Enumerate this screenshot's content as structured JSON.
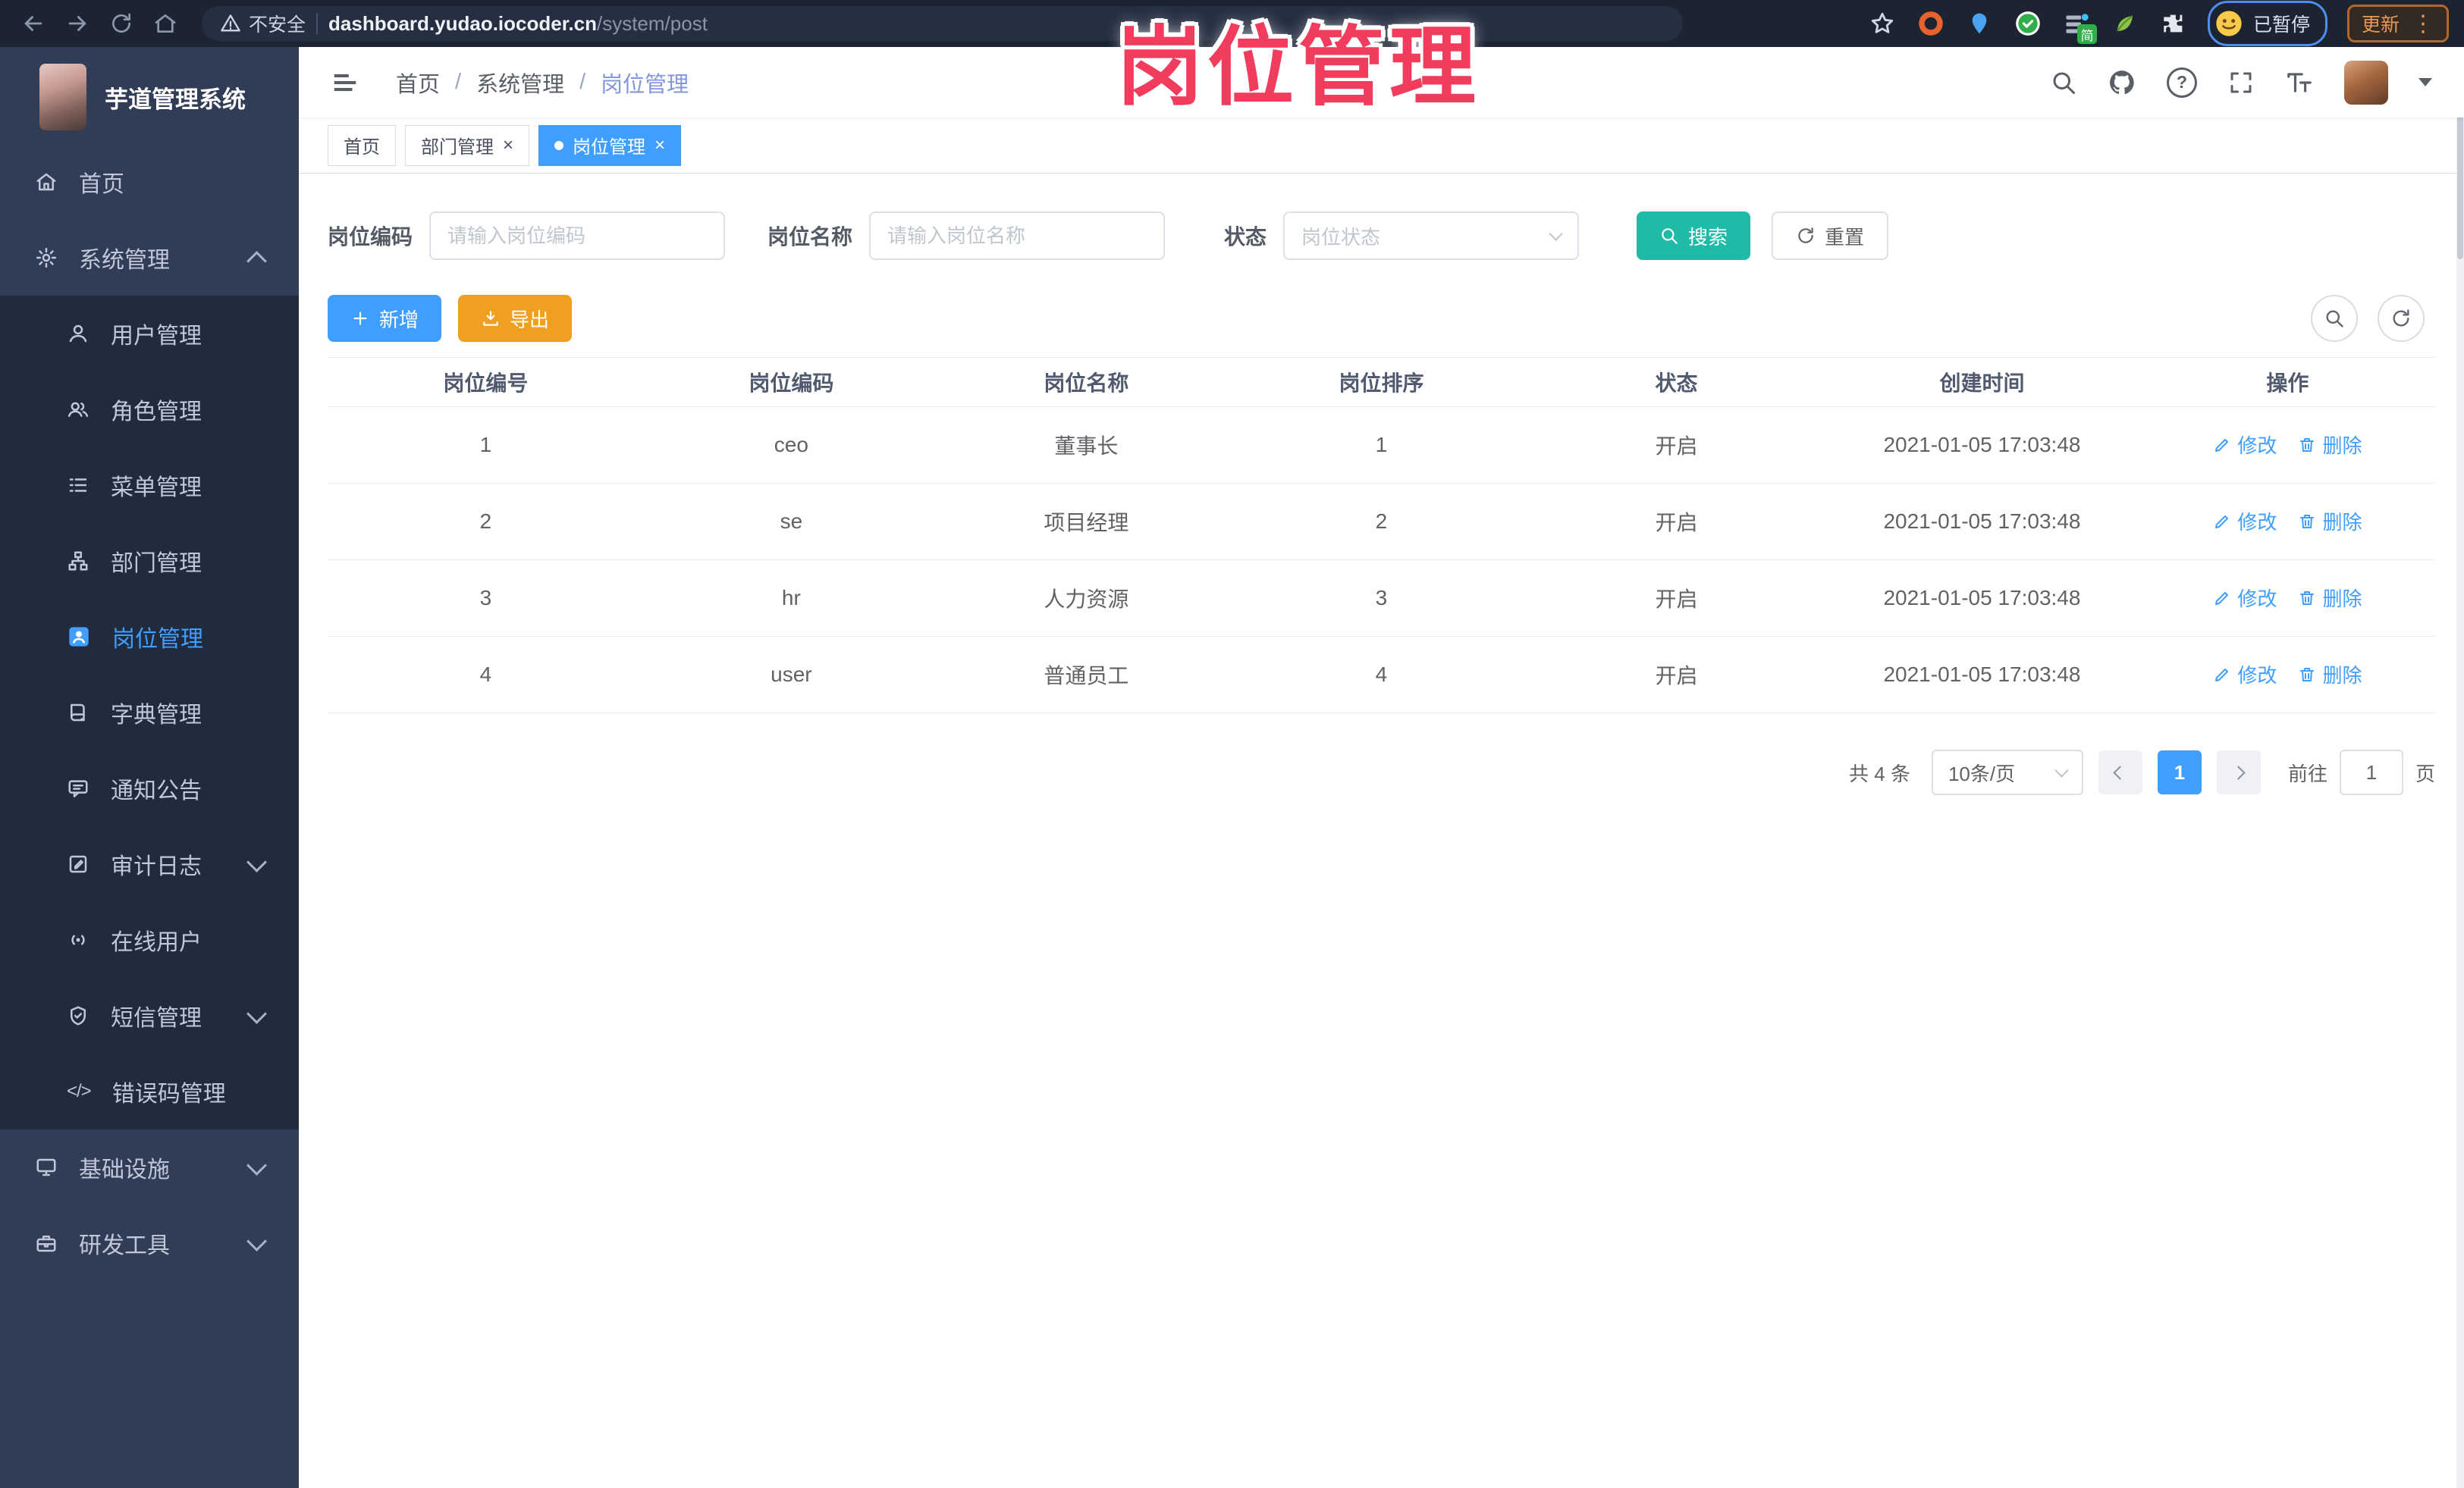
{
  "browser": {
    "security_label": "不安全",
    "url_host": "dashboard.yudao.iocoder.cn",
    "url_path": "/system/post",
    "ext_badge": "简",
    "profile_badge": "已暂停",
    "update_label": "更新"
  },
  "overlay_title": "岗位管理",
  "app": {
    "logo_title": "芋道管理系统",
    "breadcrumb": {
      "items": [
        "首页",
        "系统管理",
        "岗位管理"
      ],
      "separator": "/"
    },
    "tabs": [
      {
        "label": "首页",
        "closable": false,
        "active": false
      },
      {
        "label": "部门管理",
        "closable": true,
        "active": false
      },
      {
        "label": "岗位管理",
        "closable": true,
        "active": true
      }
    ]
  },
  "sidebar": {
    "items": [
      {
        "label": "首页",
        "icon": "home-icon",
        "level": "top"
      },
      {
        "label": "系统管理",
        "icon": "gear-icon",
        "level": "top",
        "chevron": "up"
      },
      {
        "label": "用户管理",
        "icon": "user-icon",
        "level": "sub"
      },
      {
        "label": "角色管理",
        "icon": "role-icon",
        "level": "sub"
      },
      {
        "label": "菜单管理",
        "icon": "menu-list-icon",
        "level": "sub"
      },
      {
        "label": "部门管理",
        "icon": "dept-tree-icon",
        "level": "sub"
      },
      {
        "label": "岗位管理",
        "icon": "post-icon",
        "level": "sub",
        "active": true
      },
      {
        "label": "字典管理",
        "icon": "dict-book-icon",
        "level": "sub"
      },
      {
        "label": "通知公告",
        "icon": "notice-icon",
        "level": "sub"
      },
      {
        "label": "审计日志",
        "icon": "audit-log-icon",
        "level": "sub",
        "chevron": "down"
      },
      {
        "label": "在线用户",
        "icon": "online-users-icon",
        "level": "sub"
      },
      {
        "label": "短信管理",
        "icon": "sms-shield-icon",
        "level": "sub",
        "chevron": "down"
      },
      {
        "label": "错误码管理",
        "icon": "code-icon",
        "level": "sub"
      },
      {
        "label": "基础设施",
        "icon": "infra-monitor-icon",
        "level": "top",
        "chevron": "down"
      },
      {
        "label": "研发工具",
        "icon": "dev-tools-icon",
        "level": "top",
        "chevron": "down"
      }
    ]
  },
  "filters": {
    "post_code_label": "岗位编码",
    "post_code_placeholder": "请输入岗位编码",
    "post_name_label": "岗位名称",
    "post_name_placeholder": "请输入岗位名称",
    "status_label": "状态",
    "status_placeholder": "岗位状态",
    "search_label": "搜索",
    "reset_label": "重置"
  },
  "toolbar": {
    "add_label": "新增",
    "export_label": "导出"
  },
  "table": {
    "headers": [
      "岗位编号",
      "岗位编码",
      "岗位名称",
      "岗位排序",
      "状态",
      "创建时间",
      "操作"
    ],
    "ops": {
      "edit": "修改",
      "delete": "删除"
    },
    "rows": [
      {
        "id": "1",
        "code": "ceo",
        "name": "董事长",
        "sort": "1",
        "status": "开启",
        "created": "2021-01-05 17:03:48"
      },
      {
        "id": "2",
        "code": "se",
        "name": "项目经理",
        "sort": "2",
        "status": "开启",
        "created": "2021-01-05 17:03:48"
      },
      {
        "id": "3",
        "code": "hr",
        "name": "人力资源",
        "sort": "3",
        "status": "开启",
        "created": "2021-01-05 17:03:48"
      },
      {
        "id": "4",
        "code": "user",
        "name": "普通员工",
        "sort": "4",
        "status": "开启",
        "created": "2021-01-05 17:03:48"
      }
    ]
  },
  "pagination": {
    "total_text": "共 4 条",
    "page_size_text": "10条/页",
    "current_page": "1",
    "goto_label": "前往",
    "goto_value": "1",
    "page_unit": "页"
  },
  "colors": {
    "accent_blue": "#409eff",
    "teal_search": "#20bba7",
    "orange_export": "#f0a020",
    "sidebar_bg": "#313d56",
    "sidebar_submenu_bg": "#202b3d",
    "overlay_pink": "#f23c5e",
    "browser_bar_bg": "#1c2432",
    "breadcrumb_current": "#8495dd"
  }
}
